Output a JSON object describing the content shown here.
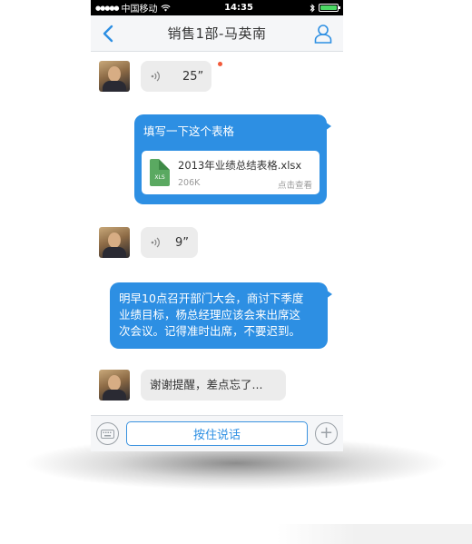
{
  "status_bar": {
    "carrier": "中国移动",
    "time": "14:35",
    "signal_dots": "●●●●●"
  },
  "nav": {
    "title": "销售1部-马英南",
    "back_icon": "chevron-left-icon",
    "profile_icon": "user-icon"
  },
  "messages": [
    {
      "type": "voice",
      "direction": "in",
      "duration": "25”",
      "unread": true
    },
    {
      "type": "file",
      "direction": "out",
      "text": "填写一下这个表格",
      "file": {
        "name": "2013年业绩总结表格.xlsx",
        "size": "206K",
        "action": "点击查看",
        "icon_label": "XLS"
      }
    },
    {
      "type": "voice",
      "direction": "in",
      "duration": "9”",
      "unread": false
    },
    {
      "type": "text",
      "direction": "out",
      "lines": [
        "明早10点召开部门大会，商讨下季度",
        "业绩目标，杨总经理应该会来出席这",
        "次会议。记得准时出席，不要迟到。"
      ]
    },
    {
      "type": "text",
      "direction": "in",
      "text": "谢谢提醒，差点忘了..."
    }
  ],
  "input_bar": {
    "hold_to_talk": "按住说话",
    "keyboard_icon": "keyboard-icon",
    "plus_icon": "plus-icon"
  },
  "colors": {
    "accent": "#2d8fe3",
    "incoming_bubble": "#ececec",
    "unread_dot": "#f25a3a"
  }
}
